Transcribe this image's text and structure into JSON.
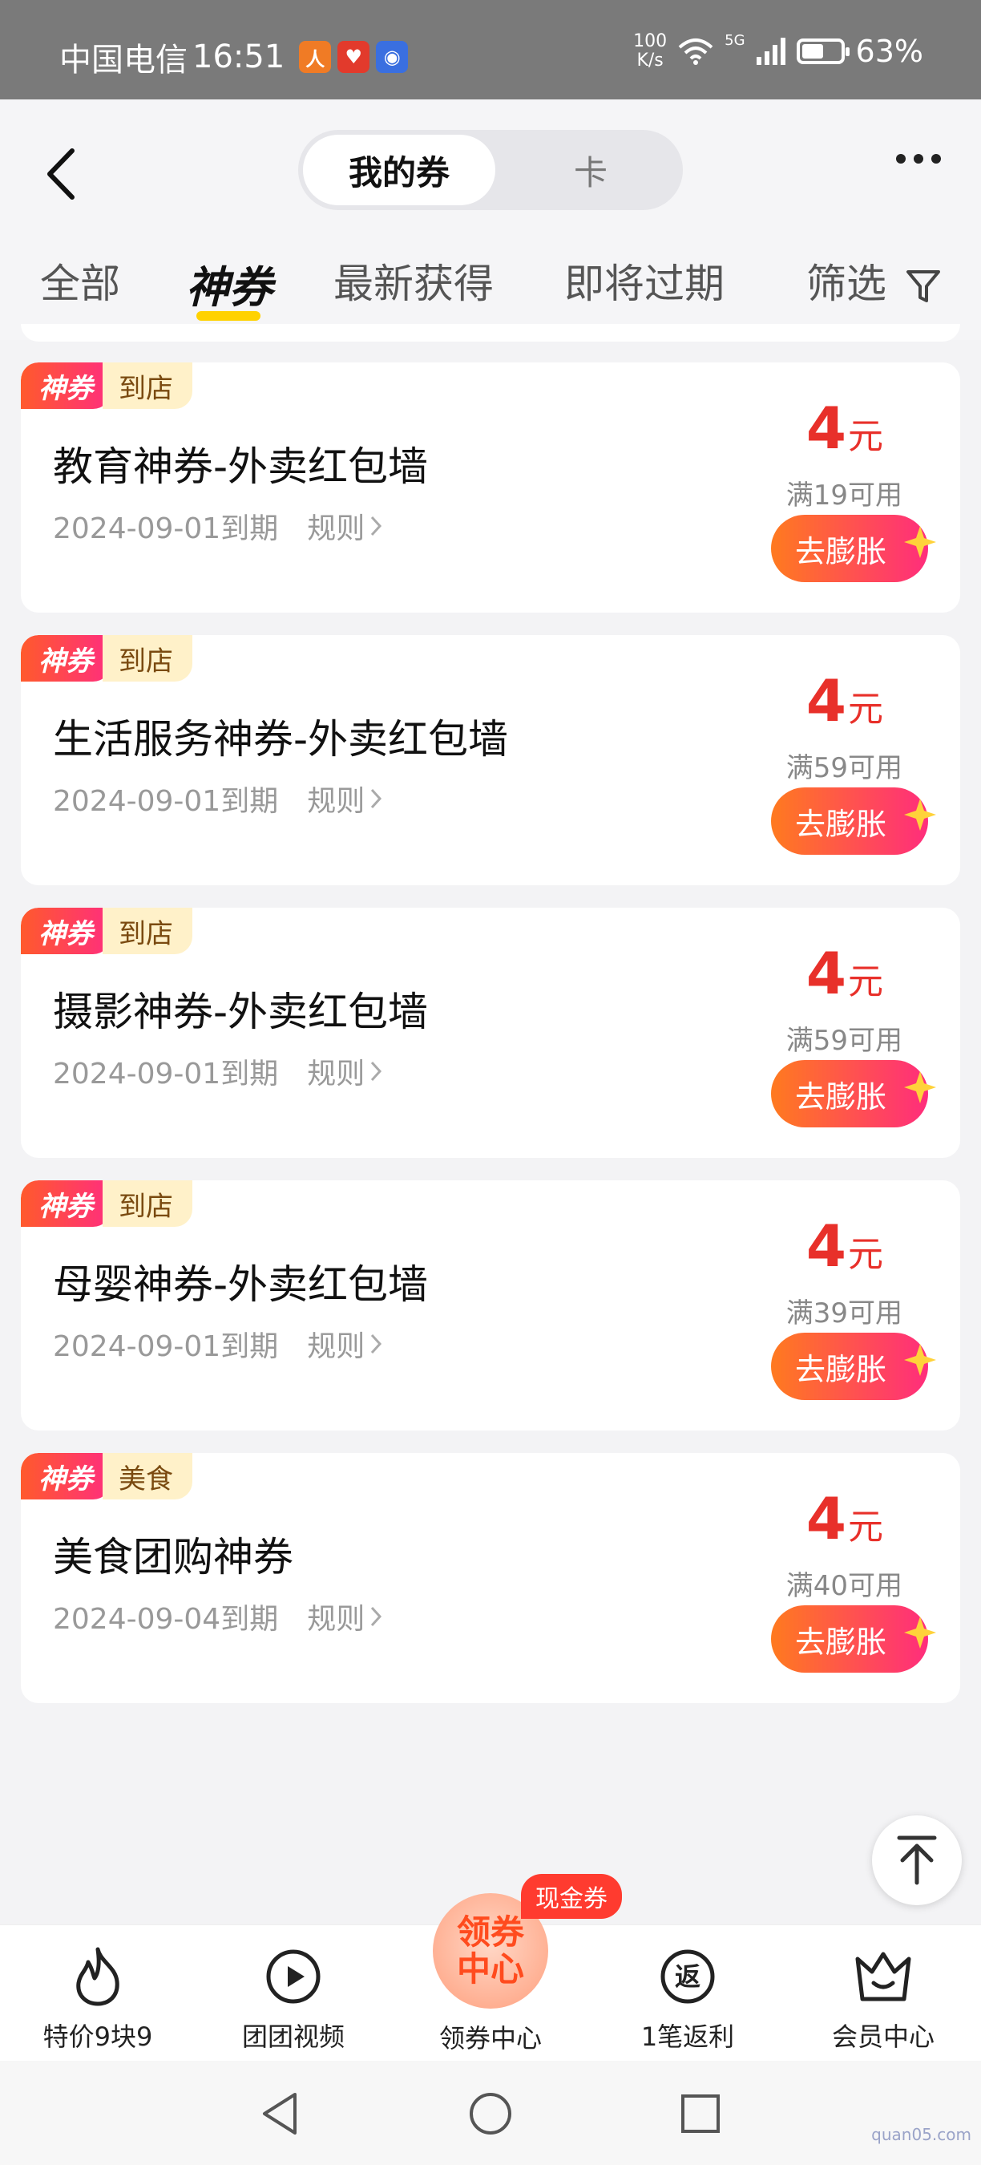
{
  "status_bar": {
    "carrier": "中国电信",
    "time": "16:51",
    "net_speed_value": "100",
    "net_speed_unit": "K/s",
    "network": "5G",
    "battery_percent": "63%",
    "battery_level": 0.63
  },
  "header": {
    "segment_active": "我的券",
    "segment_other": "卡"
  },
  "tabs": [
    {
      "label": "全部"
    },
    {
      "label": "神券"
    },
    {
      "label": "最新获得"
    },
    {
      "label": "即将过期"
    },
    {
      "label": "筛选"
    }
  ],
  "coupons": [
    {
      "tag": "神券",
      "sub_tag": "到店",
      "title": "教育神券-外卖红包墙",
      "expire": "2024-09-01到期",
      "rule": "规则",
      "amount": "4",
      "unit": "元",
      "condition": "满19可用",
      "button": "去膨胀"
    },
    {
      "tag": "神券",
      "sub_tag": "到店",
      "title": "生活服务神券-外卖红包墙",
      "expire": "2024-09-01到期",
      "rule": "规则",
      "amount": "4",
      "unit": "元",
      "condition": "满59可用",
      "button": "去膨胀"
    },
    {
      "tag": "神券",
      "sub_tag": "到店",
      "title": "摄影神券-外卖红包墙",
      "expire": "2024-09-01到期",
      "rule": "规则",
      "amount": "4",
      "unit": "元",
      "condition": "满59可用",
      "button": "去膨胀"
    },
    {
      "tag": "神券",
      "sub_tag": "到店",
      "title": "母婴神券-外卖红包墙",
      "expire": "2024-09-01到期",
      "rule": "规则",
      "amount": "4",
      "unit": "元",
      "condition": "满39可用",
      "button": "去膨胀"
    },
    {
      "tag": "神券",
      "sub_tag": "美食",
      "title": "美食团购神券",
      "expire": "2024-09-04到期",
      "rule": "规则",
      "amount": "4",
      "unit": "元",
      "condition": "满40可用",
      "button": "去膨胀"
    }
  ],
  "bottom_nav": {
    "items": [
      {
        "label": "特价9块9",
        "icon": "flame-icon"
      },
      {
        "label": "团团视频",
        "icon": "play-icon"
      },
      {
        "label": "1笔返利",
        "icon": "rebate-icon"
      },
      {
        "label": "会员中心",
        "icon": "crown-icon"
      }
    ],
    "center_label": "领券中心",
    "center_line1": "领券",
    "center_line2": "中心",
    "center_badge": "现金券"
  },
  "watermark": "quan05.com",
  "colors": {
    "accent": "#ff2d7c",
    "price": "#e8302a",
    "tab_underline": "#ffd200"
  }
}
